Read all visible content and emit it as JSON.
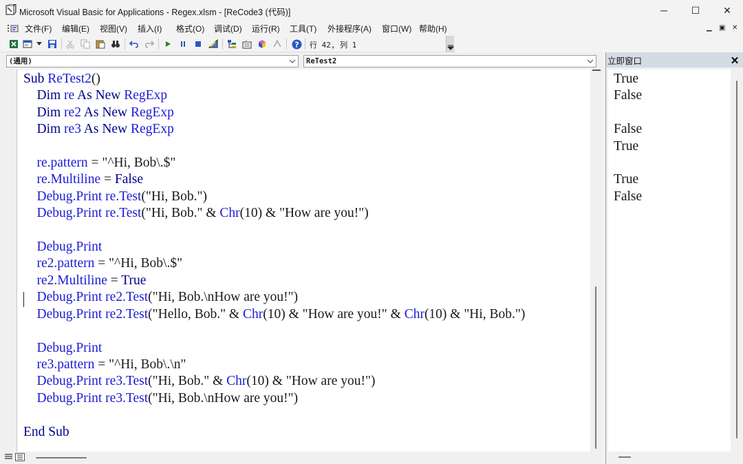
{
  "window": {
    "title": "Microsoft Visual Basic for Applications - Regex.xlsm - [ReCode3 (代码)]",
    "minimize": "─",
    "maximize": "☐",
    "close": "✕"
  },
  "menu": {
    "items": [
      "文件(F)",
      "编辑(E)",
      "视图(V)",
      "插入(I)",
      "格式(O)",
      "调试(D)",
      "运行(R)",
      "工具(T)",
      "外接程序(A)",
      "窗口(W)",
      "帮助(H)"
    ],
    "mdi_min": "▁",
    "mdi_restore": "▣",
    "mdi_close": "✕"
  },
  "toolbar": {
    "position": "行 42, 列 1"
  },
  "code_window": {
    "object_combo": "(通用)",
    "proc_combo": "ReTest2"
  },
  "immediate": {
    "title": "立即窗口",
    "close": "✕",
    "lines": [
      "True",
      "False",
      "",
      "False",
      "True",
      "",
      "True",
      "False"
    ]
  },
  "code": {
    "lines": [
      [
        "Sub ReTest2()"
      ],
      [
        "    Dim re As New RegExp"
      ],
      [
        "    Dim re2 As New RegExp"
      ],
      [
        "    Dim re3 As New RegExp"
      ],
      [
        ""
      ],
      [
        "    re.pattern = \"^Hi, Bob\\.$\""
      ],
      [
        "    re.Multiline = False"
      ],
      [
        "    Debug.Print re.Test(\"Hi, Bob.\")"
      ],
      [
        "    Debug.Print re.Test(\"Hi, Bob.\" & Chr(10) & \"How are you!\")"
      ],
      [
        ""
      ],
      [
        "    Debug.Print"
      ],
      [
        "    re2.pattern = \"^Hi, Bob\\.$\""
      ],
      [
        "    re2.Multiline = True"
      ],
      [
        "    Debug.Print re2.Test(\"Hi, Bob.\\nHow are you!\")"
      ],
      [
        "    Debug.Print re2.Test(\"Hello, Bob.\" & Chr(10) & \"How are you!\" & Chr(10) & \"Hi, Bob.\")"
      ],
      [
        ""
      ],
      [
        "    Debug.Print"
      ],
      [
        "    re3.pattern = \"^Hi, Bob\\.\\n\""
      ],
      [
        "    Debug.Print re3.Test(\"Hi, Bob.\" & Chr(10) & \"How are you!\")"
      ],
      [
        "    Debug.Print re3.Test(\"Hi, Bob.\\nHow are you!\")"
      ],
      [
        ""
      ],
      [
        "End Sub"
      ]
    ]
  }
}
